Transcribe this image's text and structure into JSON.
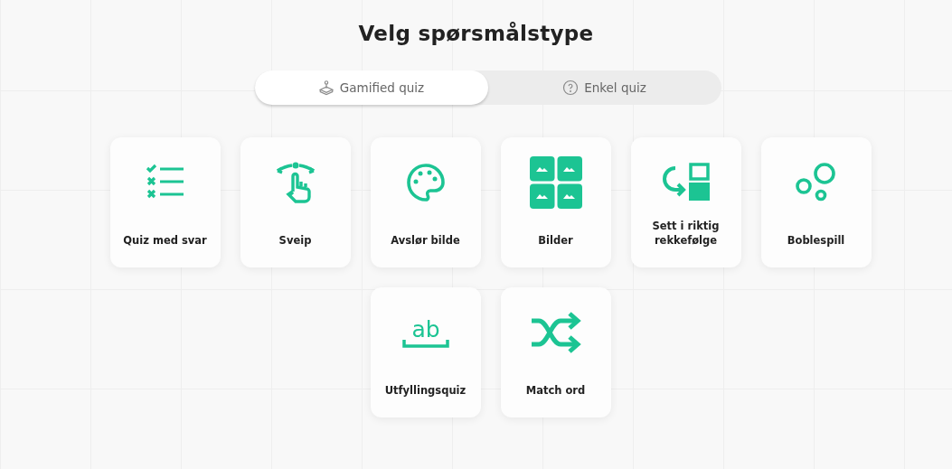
{
  "title": "Velg spørsmålstype",
  "tabs": [
    {
      "label": "Gamified quiz",
      "selected": true
    },
    {
      "label": "Enkel quiz",
      "selected": false
    }
  ],
  "cards": [
    {
      "label": "Quiz med svar"
    },
    {
      "label": "Sveip"
    },
    {
      "label": "Avslør bilde"
    },
    {
      "label": "Bilder"
    },
    {
      "label": "Sett i riktig rekkefølge"
    },
    {
      "label": "Boblespill"
    },
    {
      "label": "Utfyllingsquiz",
      "icon_text": "ab"
    },
    {
      "label": "Match ord"
    }
  ]
}
